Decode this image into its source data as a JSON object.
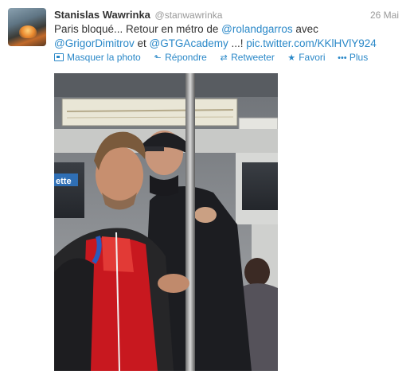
{
  "tweet": {
    "fullname": "Stanislas Wawrinka",
    "username": "@stanwawrinka",
    "timestamp": "26 Mai",
    "text": {
      "part1": "Paris bloqué... Retour en métro de ",
      "mention1": "@rolandgarros",
      "part2": " avec ",
      "mention2": "@GrigorDimitrov",
      "part3": " et ",
      "mention3": "@GTGAcademy",
      "part4": " ...! ",
      "link": "pic.twitter.com/KKlHVlY924"
    }
  },
  "actions": {
    "hide_photo": "Masquer la photo",
    "reply": "Répondre",
    "retweet": "Retweeter",
    "favorite": "Favori",
    "more": "Plus"
  },
  "photo": {
    "sign_text": "ette"
  },
  "icons": {
    "avatar": "user-avatar",
    "hide_photo": "photo-icon",
    "reply": "reply-arrow-icon",
    "retweet": "retweet-icon",
    "favorite": "star-icon",
    "more": "more-dots-icon"
  },
  "colors": {
    "link": "#2a88c8",
    "text": "#333333",
    "muted": "#999999"
  }
}
